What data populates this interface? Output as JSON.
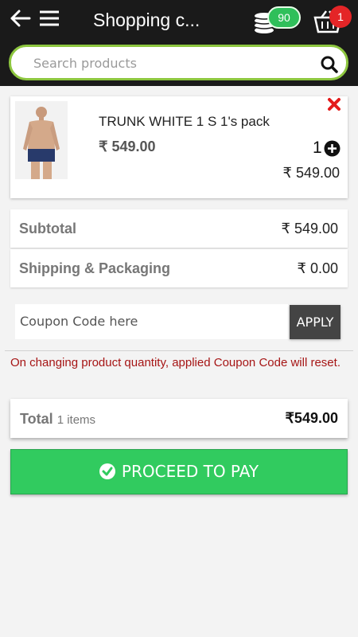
{
  "header": {
    "title": "Shopping c...",
    "coins_count": "90",
    "cart_count": "1",
    "colors": {
      "bar": "#1a1a1a",
      "coins_badge": "#2fbf5a",
      "cart_badge": "#e42527"
    }
  },
  "search": {
    "placeholder": "Search products",
    "accent": "#8dc63f"
  },
  "cart_item": {
    "name": "TRUNK WHITE 1 S 1's pack",
    "price": "₹ 549.00",
    "quantity": "1",
    "line_total": "₹ 549.00",
    "image_icon": "product-photo"
  },
  "summary": {
    "subtotal_label": "Subtotal",
    "subtotal_value": "₹ 549.00",
    "shipping_label": "Shipping & Packaging",
    "shipping_value": "₹ 0.00"
  },
  "coupon": {
    "placeholder": "Coupon Code here",
    "apply_label": "APPLY",
    "notice": "On changing product quantity, applied Coupon Code will reset."
  },
  "total": {
    "label": "Total",
    "items": "1 items",
    "value": "₹549.00"
  },
  "pay_button": {
    "label": "PROCEED TO PAY",
    "color": "#31cb5f"
  }
}
